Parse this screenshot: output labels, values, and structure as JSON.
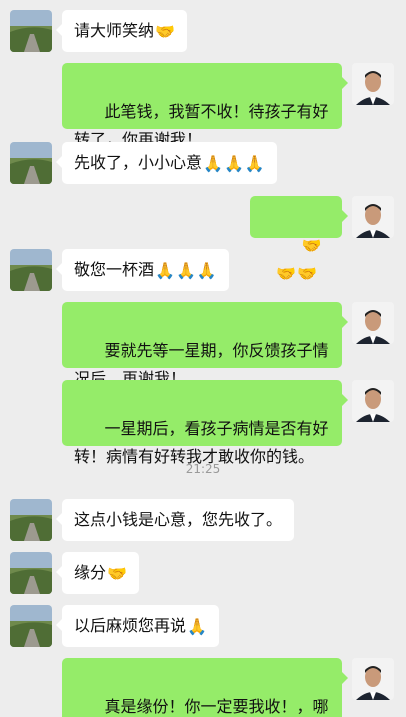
{
  "timestamp": "21:25",
  "emoji": {
    "handshake": "🤝",
    "palms": "🙏"
  },
  "messages": [
    {
      "side": "recv",
      "text": "请大师笑纳",
      "emoji": "handshake",
      "emoji_count": 1
    },
    {
      "side": "sent",
      "text": "此笔钱，我暂不收！待孩子有好转了，你再谢我！",
      "emoji": null,
      "emoji_count": 0
    },
    {
      "side": "recv",
      "text": "先收了，小小心意",
      "emoji": "palms",
      "emoji_count": 3
    },
    {
      "side": "sent",
      "text": "",
      "emoji": "handshake",
      "emoji_count": 3
    },
    {
      "side": "recv",
      "text": "敬您一杯酒",
      "emoji": "palms",
      "emoji_count": 3
    },
    {
      "side": "sent",
      "text": "要就先等一星期，你反馈孩子情况后，再谢我！",
      "emoji": null,
      "emoji_count": 0
    },
    {
      "side": "sent",
      "text": "一星期后，看孩子病情是否有好转！病情有好转我才敢收你的钱。",
      "emoji": null,
      "emoji_count": 0
    },
    {
      "side": "recv",
      "text": "这点小钱是心意，您先收了。",
      "emoji": null,
      "emoji_count": 0
    },
    {
      "side": "recv",
      "text": "缘分",
      "emoji": "handshake",
      "emoji_count": 1
    },
    {
      "side": "recv",
      "text": "以后麻烦您再说",
      "emoji": "palms",
      "emoji_count": 1
    },
    {
      "side": "sent",
      "text": "真是缘份！你一定要我收！，哪我先收下。一星期后反馈孩子的情",
      "emoji": null,
      "emoji_count": 0
    }
  ],
  "colors": {
    "background": "#ededed",
    "sent_bubble": "#95ec69",
    "recv_bubble": "#ffffff",
    "timestamp": "#9a9a9a"
  }
}
